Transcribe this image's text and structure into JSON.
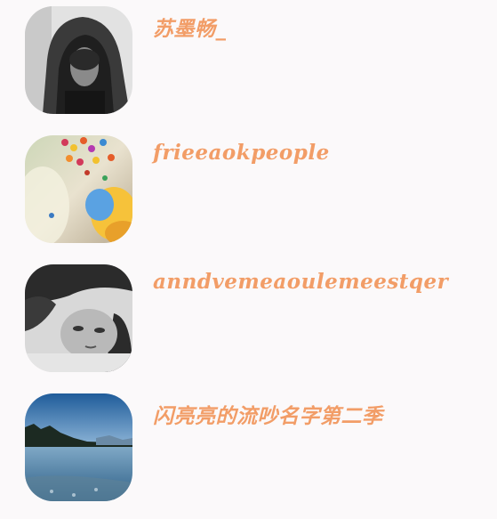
{
  "theme": {
    "name_color": "#f29d67",
    "background": "#fbf9fa"
  },
  "contacts": [
    {
      "name": "苏墨畅_",
      "avatar": "hooded-person-bw-photo"
    },
    {
      "name": "frieeaokpeople",
      "avatar": "colorful-flowers-photo"
    },
    {
      "name": "anndvemeaoulemeestqer",
      "avatar": "reclining-person-bw-photo"
    },
    {
      "name": "闪亮亮的流吵名字第二季",
      "avatar": "lake-landscape-photo"
    }
  ]
}
